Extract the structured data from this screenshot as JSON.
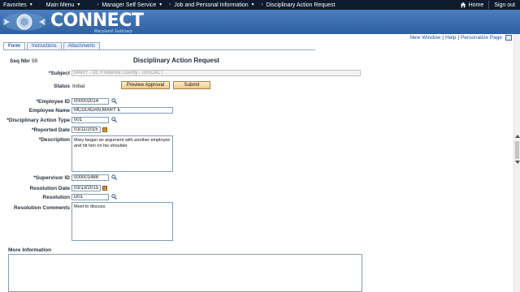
{
  "topnav": {
    "favorites": "Favorites",
    "main_menu": "Main Menu",
    "breadcrumb": [
      "Manager Self Service",
      "Job and Personal Information",
      "Disciplinary Action Request"
    ],
    "home": "Home",
    "sign_out": "Sign out"
  },
  "banner": {
    "brand": "CONNECT",
    "subtitle": "Maryland Judiciary"
  },
  "toplinks": {
    "new_window": "New Window",
    "help": "Help",
    "personalize": "Personalize Page"
  },
  "tabs": [
    "Form",
    "Instructions",
    "Attachments"
  ],
  "form": {
    "seq_label": "Seq Nbr",
    "seq_value": "99",
    "title": "Disciplinary Action Request",
    "subject_label": "*Subject",
    "subject_value": "MARY - DC Frederick County - DISCACT",
    "status_label": "Status",
    "status_value": "Initial",
    "preview_button": "Preview Approval",
    "submit_button": "Submit",
    "employee_id_label": "*Employee ID",
    "employee_id_value": "000002014",
    "employee_name_label": "Employee Name",
    "employee_name_value": "MCGUIGAN,MARY E",
    "action_type_label": "*Disciplinary Action Type",
    "action_type_value": "001",
    "reported_date_label": "*Reported Date",
    "reported_date_value": "03/11/2015",
    "description_label": "*Description",
    "description_value": "Mary began an argument with another employee and hit him on his shoulder.",
    "supervisor_id_label": "*Supervisor ID",
    "supervisor_id_value": "000001488",
    "resolution_date_label": "Resolution Date",
    "resolution_date_value": "03/13/2015",
    "resolution_label": "Resolution",
    "resolution_value": "D01",
    "resolution_comments_label": "Resolution Comments",
    "resolution_comments_value": "Meet to discuss.",
    "more_info_label": "More Information"
  }
}
